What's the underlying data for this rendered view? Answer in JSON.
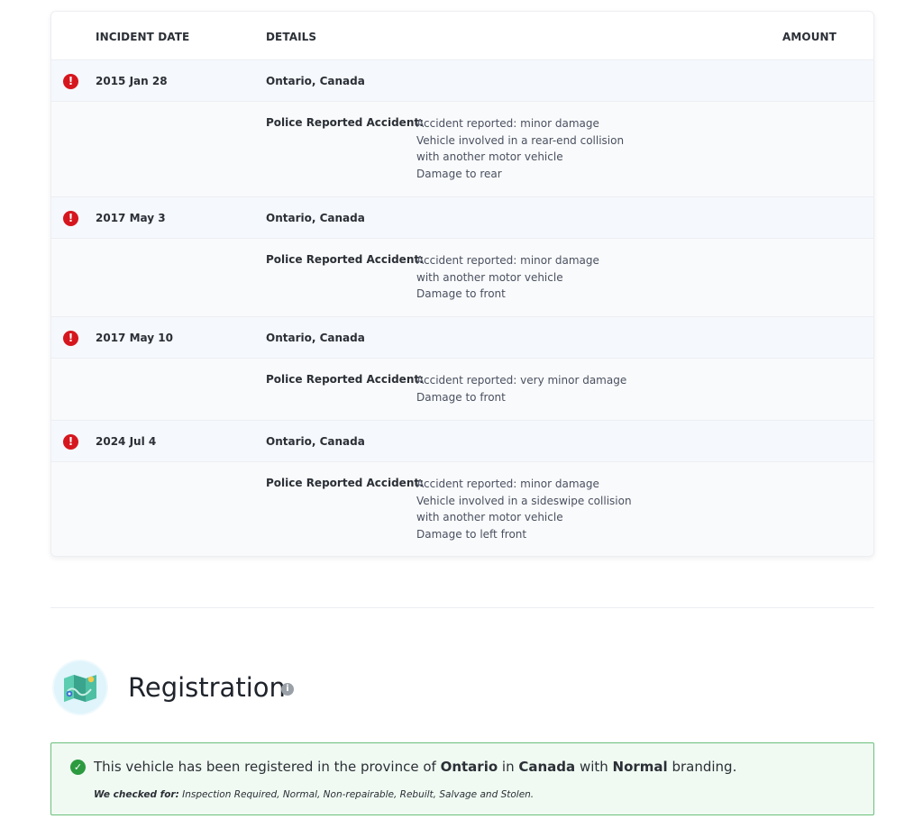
{
  "table": {
    "headers": {
      "date": "INCIDENT DATE",
      "details": "DETAILS",
      "amount": "AMOUNT"
    },
    "incidents": [
      {
        "date": "2015 Jan 28",
        "location": "Ontario, Canada",
        "category": "Police Reported Accident:",
        "lines": [
          "Accident reported: minor damage",
          "Vehicle involved in a rear-end collision",
          "with another motor vehicle",
          "Damage to rear"
        ]
      },
      {
        "date": "2017 May 3",
        "location": "Ontario, Canada",
        "category": "Police Reported Accident:",
        "lines": [
          "Accident reported: minor damage",
          "with another motor vehicle",
          "Damage to front"
        ]
      },
      {
        "date": "2017 May 10",
        "location": "Ontario, Canada",
        "category": "Police Reported Accident:",
        "lines": [
          "Accident reported: very minor damage",
          "Damage to front"
        ]
      },
      {
        "date": "2024 Jul 4",
        "location": "Ontario, Canada",
        "category": "Police Reported Accident:",
        "lines": [
          "Accident reported: minor damage",
          "Vehicle involved in a sideswipe collision",
          "with another motor vehicle",
          "Damage to left front"
        ]
      }
    ]
  },
  "registration": {
    "title": "Registration",
    "message": {
      "prefix": "This vehicle has been registered in the province of ",
      "province": "Ontario",
      "mid1": " in ",
      "country": "Canada",
      "mid2": " with ",
      "branding": "Normal",
      "suffix": " branding."
    },
    "checked_label": "We checked for:",
    "checked_text": " Inspection Required, Normal, Non-repairable, Rebuilt, Salvage and Stolen."
  },
  "icons": {
    "alert": "exclamation-circle-icon",
    "info": "info-icon",
    "check": "check-circle-icon",
    "map": "map-icon"
  },
  "colors": {
    "alert": "#d6161e",
    "success_border": "#6cc07a",
    "success_bg": "#f0faf2",
    "check": "#2c9a3f"
  }
}
